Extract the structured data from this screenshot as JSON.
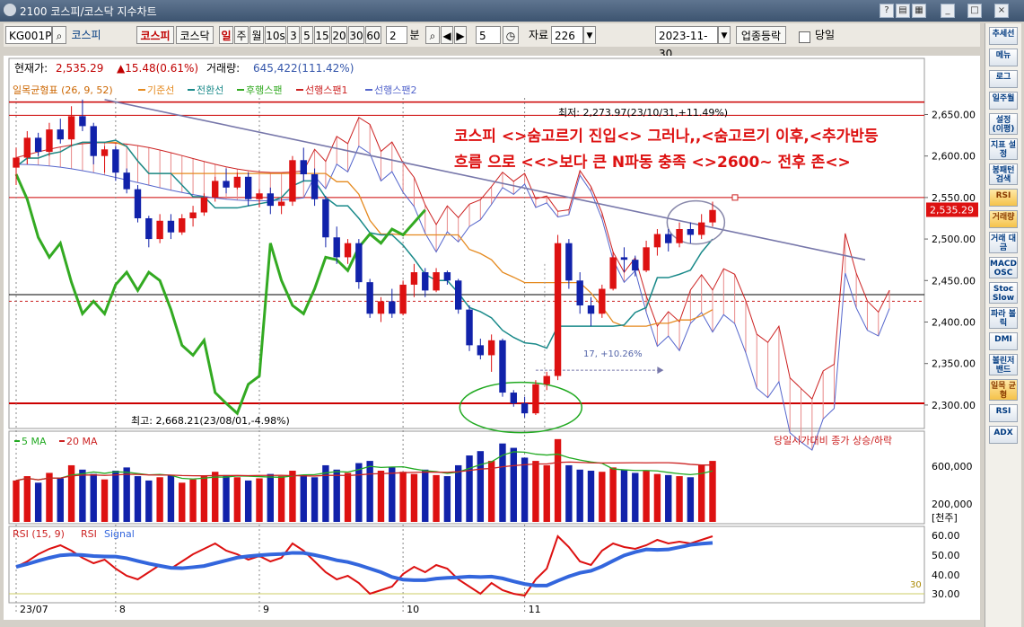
{
  "window": {
    "title": "2100 코스피/코스닥 지수차트"
  },
  "toolbar": {
    "code": "KG001P",
    "name": "코스피",
    "btn_kospi": "코스피",
    "btn_kosdaq": "코스닥",
    "periods": [
      "일",
      "주",
      "월",
      "10s",
      "3",
      "5",
      "15",
      "20",
      "30",
      "60"
    ],
    "interval_value": "2",
    "interval_unit": "분",
    "count_value": "5",
    "data_label": "자료",
    "data_count": "226",
    "date": "2023-11-30",
    "sector_label": "업종등락",
    "sameday_label": "당일"
  },
  "info": {
    "price_label": "현재가:",
    "price": "2,535.29",
    "change": "▲15.48(0.61%)",
    "volume_label": "거래량:",
    "volume": "645,422(111.42%)"
  },
  "legend_top": {
    "indicator": "일목균형표 (26, 9, 52)",
    "items": [
      {
        "name": "기준선",
        "color": "#e58a1f"
      },
      {
        "name": "전환선",
        "color": "#1a8a8a"
      },
      {
        "name": "후행스팬",
        "color": "#33aa22"
      },
      {
        "name": "선행스팬1",
        "color": "#cc2222"
      },
      {
        "name": "선행스팬2",
        "color": "#5566cc"
      }
    ]
  },
  "annotations": {
    "max_label": "최저: 2,273.97(23/10/31,+11.49%)",
    "min_label": "최고: 2,668.21(23/08/01,-4.98%)",
    "range_label": "17, +10.26%",
    "headline_1": "코스피 <>숨고르기 진입<> 그러나,,<숨고르기 이후,<추가반등",
    "headline_2": "흐름 으로 <<>보다 큰 N파동 충족 <>2600~ 전후 존<>",
    "price_tag": "2,535.29"
  },
  "volume_panel": {
    "legend": [
      {
        "name": "5 MA",
        "color": "#22aa22"
      },
      {
        "name": "20 MA",
        "color": "#cc2222"
      }
    ],
    "note": "당일시가대비 종가 상승/하락",
    "axis_labels": [
      "600,000",
      "200,000"
    ],
    "unit": "[천주]"
  },
  "rsi_panel": {
    "legend": "RSI (15, 9)",
    "series_names": [
      "RSI",
      "Signal"
    ],
    "axis_labels": [
      "60.00",
      "50.00",
      "40.00",
      "30.00"
    ],
    "level_label": "30"
  },
  "x_axis": {
    "labels": [
      "23/07",
      "8",
      "9",
      "10",
      "11"
    ]
  },
  "sidebar": {
    "items": [
      "추세선",
      "메뉴",
      "로그",
      "일주월",
      "설정 (이평)",
      "지표 설정",
      "봉패턴 검색",
      "RSI",
      "거래량",
      "거래 대금",
      "MACD OSC",
      "Stoc Slow",
      "파라 볼릭",
      "DMI",
      "볼린저 밴드",
      "일목 균형",
      "RSI",
      "ADX"
    ]
  },
  "chart_data": {
    "type": "candlestick",
    "y_axis_labels": [
      "2,650.00",
      "2,600.00",
      "2,550.00",
      "2,500.00",
      "2,450.00",
      "2,400.00",
      "2,350.00",
      "2,300.00"
    ],
    "ylim": [
      2275,
      2670
    ],
    "x_labels": [
      "23/07",
      "8",
      "9",
      "10",
      "11"
    ],
    "candles_ohlc": [
      [
        2586,
        2610,
        2565,
        2598
      ],
      [
        2598,
        2630,
        2590,
        2622
      ],
      [
        2622,
        2628,
        2600,
        2605
      ],
      [
        2605,
        2640,
        2600,
        2632
      ],
      [
        2632,
        2645,
        2615,
        2620
      ],
      [
        2620,
        2660,
        2612,
        2648
      ],
      [
        2648,
        2668,
        2630,
        2636
      ],
      [
        2636,
        2640,
        2590,
        2600
      ],
      [
        2600,
        2612,
        2580,
        2608
      ],
      [
        2608,
        2612,
        2570,
        2580
      ],
      [
        2580,
        2585,
        2555,
        2560
      ],
      [
        2560,
        2565,
        2520,
        2525
      ],
      [
        2525,
        2528,
        2490,
        2500
      ],
      [
        2500,
        2530,
        2495,
        2522
      ],
      [
        2522,
        2530,
        2500,
        2508
      ],
      [
        2508,
        2530,
        2505,
        2525
      ],
      [
        2525,
        2540,
        2515,
        2532
      ],
      [
        2532,
        2555,
        2528,
        2550
      ],
      [
        2550,
        2575,
        2545,
        2570
      ],
      [
        2570,
        2585,
        2555,
        2562
      ],
      [
        2562,
        2580,
        2560,
        2575
      ],
      [
        2575,
        2580,
        2540,
        2548
      ],
      [
        2548,
        2560,
        2538,
        2555
      ],
      [
        2555,
        2562,
        2530,
        2540
      ],
      [
        2540,
        2550,
        2530,
        2545
      ],
      [
        2545,
        2600,
        2540,
        2595
      ],
      [
        2595,
        2610,
        2570,
        2578
      ],
      [
        2578,
        2585,
        2540,
        2548
      ],
      [
        2548,
        2552,
        2490,
        2502
      ],
      [
        2502,
        2515,
        2470,
        2478
      ],
      [
        2478,
        2500,
        2470,
        2495
      ],
      [
        2495,
        2500,
        2440,
        2448
      ],
      [
        2448,
        2452,
        2405,
        2410
      ],
      [
        2410,
        2430,
        2400,
        2425
      ],
      [
        2425,
        2440,
        2405,
        2410
      ],
      [
        2410,
        2450,
        2408,
        2445
      ],
      [
        2445,
        2470,
        2430,
        2460
      ],
      [
        2460,
        2465,
        2430,
        2438
      ],
      [
        2438,
        2465,
        2436,
        2460
      ],
      [
        2460,
        2462,
        2445,
        2450
      ],
      [
        2450,
        2452,
        2410,
        2415
      ],
      [
        2415,
        2420,
        2365,
        2372
      ],
      [
        2372,
        2380,
        2355,
        2360
      ],
      [
        2360,
        2385,
        2340,
        2378
      ],
      [
        2378,
        2380,
        2310,
        2315
      ],
      [
        2315,
        2318,
        2298,
        2302
      ],
      [
        2302,
        2310,
        2285,
        2290
      ],
      [
        2290,
        2330,
        2288,
        2325
      ],
      [
        2325,
        2340,
        2318,
        2335
      ],
      [
        2335,
        2505,
        2330,
        2495
      ],
      [
        2495,
        2500,
        2440,
        2450
      ],
      [
        2450,
        2460,
        2410,
        2420
      ],
      [
        2420,
        2430,
        2395,
        2410
      ],
      [
        2410,
        2445,
        2405,
        2440
      ],
      [
        2440,
        2485,
        2438,
        2478
      ],
      [
        2478,
        2490,
        2460,
        2475
      ],
      [
        2475,
        2480,
        2455,
        2462
      ],
      [
        2462,
        2498,
        2460,
        2490
      ],
      [
        2490,
        2512,
        2480,
        2506
      ],
      [
        2506,
        2512,
        2485,
        2495
      ],
      [
        2495,
        2520,
        2490,
        2512
      ],
      [
        2512,
        2520,
        2495,
        2505
      ],
      [
        2505,
        2530,
        2500,
        2520
      ],
      [
        2520,
        2545,
        2515,
        2535
      ]
    ],
    "volume": [
      380,
      420,
      360,
      450,
      400,
      520,
      480,
      440,
      390,
      470,
      500,
      420,
      380,
      410,
      430,
      360,
      390,
      420,
      460,
      430,
      410,
      380,
      400,
      440,
      420,
      470,
      430,
      410,
      520,
      480,
      450,
      540,
      560,
      470,
      500,
      460,
      440,
      480,
      430,
      420,
      520,
      610,
      650,
      560,
      720,
      680,
      590,
      560,
      520,
      760,
      520,
      480,
      470,
      460,
      500,
      480,
      450,
      470,
      440,
      430,
      420,
      410,
      520,
      560
    ],
    "rsi": [
      45,
      48,
      52,
      55,
      57,
      54,
      50,
      47,
      49,
      44,
      40,
      38,
      42,
      46,
      44,
      48,
      52,
      55,
      58,
      54,
      52,
      49,
      51,
      48,
      50,
      58,
      54,
      48,
      42,
      38,
      40,
      36,
      30,
      32,
      34,
      41,
      45,
      42,
      46,
      44,
      38,
      34,
      30,
      36,
      32,
      30,
      29,
      38,
      44,
      62,
      56,
      48,
      46,
      54,
      58,
      56,
      55,
      57,
      60,
      58,
      59,
      58,
      60,
      62
    ]
  }
}
